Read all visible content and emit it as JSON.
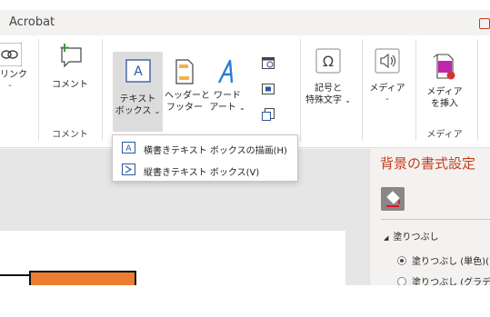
{
  "app": {
    "title": "Acrobat"
  },
  "ribbon": {
    "link": {
      "label": "リンク",
      "icon": "link-icon"
    },
    "comment": {
      "label": "コメント",
      "icon": "new-comment-icon"
    },
    "comment_group_label": "コメント",
    "textbox": {
      "label_line1": "テキスト",
      "label_line2": "ボックス",
      "icon": "text-box-icon",
      "selected": true
    },
    "header_footer": {
      "label_line1": "ヘッダーと",
      "label_line2": "フッター",
      "icon": "header-footer-icon"
    },
    "wordart": {
      "label_line1": "ワード",
      "label_line2": "アート",
      "icon": "wordart-icon"
    },
    "small_icons": [
      "date-time-icon",
      "slide-number-icon",
      "object-icon"
    ],
    "symbols": {
      "label_line1": "記号と",
      "label_line2": "特殊文字",
      "icon": "omega-symbol-icon"
    },
    "media": {
      "label": "メディア",
      "icon": "audio-speaker-icon"
    },
    "insert_media": {
      "label_line1": "メディア",
      "label_line2": "を挿入",
      "icon": "insert-media-icon"
    },
    "media_group_label": "メディア"
  },
  "dropdown": {
    "items": [
      {
        "label": "横書きテキスト ボックスの描画(H)",
        "icon": "horizontal-text-box-icon"
      },
      {
        "label": "縦書きテキスト ボックス(V)",
        "icon": "vertical-text-box-icon"
      }
    ]
  },
  "format_pane": {
    "title": "背景の書式設定",
    "tab_icon": "fill-bucket-icon",
    "section": "塗りつぶし",
    "options": [
      {
        "label": "塗りつぶし (単色)(",
        "selected": true
      },
      {
        "label": "塗りつぶし (グラデー",
        "selected": false
      }
    ]
  },
  "colors": {
    "accent": "#c43e1c",
    "ribbon_bg": "#ffffff",
    "selected_bg": "#dcdcdc",
    "shape_fill": "#ed7d31",
    "icon_blue": "#2b579a"
  }
}
